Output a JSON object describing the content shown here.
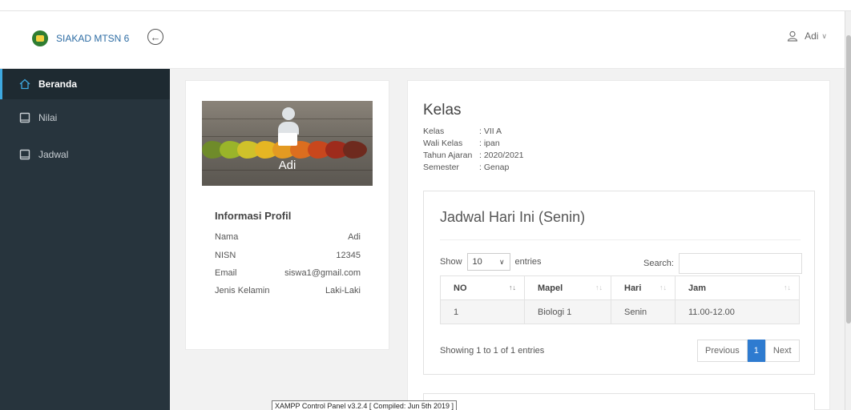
{
  "app": {
    "brand": "SIAKAD MTSN 6",
    "user_name": "Adi"
  },
  "sidebar": {
    "items": [
      {
        "label": "Beranda",
        "icon": "home-icon",
        "active": true
      },
      {
        "label": "Nilai",
        "icon": "book-icon",
        "active": false
      },
      {
        "label": "Jadwal",
        "icon": "book-icon",
        "active": false
      }
    ]
  },
  "profile": {
    "overlay_name": "Adi",
    "title": "Informasi Profil",
    "rows": [
      {
        "label": "Nama",
        "value": "Adi"
      },
      {
        "label": "NISN",
        "value": "12345"
      },
      {
        "label": "Email",
        "value": "siswa1@gmail.com"
      },
      {
        "label": "Jenis Kelamin",
        "value": "Laki-Laki"
      }
    ]
  },
  "kelas": {
    "title": "Kelas",
    "rows": [
      {
        "label": "Kelas",
        "value": ": VII A"
      },
      {
        "label": "Wali Kelas",
        "value": ": ipan"
      },
      {
        "label": "Tahun Ajaran",
        "value": ": 2020/2021"
      },
      {
        "label": "Semester",
        "value": ": Genap"
      }
    ]
  },
  "jadwal": {
    "title": "Jadwal Hari Ini (Senin)",
    "show_label": "Show",
    "entries_value": "10",
    "entries_label": "entries",
    "search_label": "Search:",
    "search_placeholder": "",
    "columns": [
      "NO",
      "Mapel",
      "Hari",
      "Jam"
    ],
    "rows": [
      [
        "1",
        "Biologi 1",
        "Senin",
        "11.00-12.00"
      ]
    ],
    "showing": "Showing 1 to 1 of 1 entries",
    "pager": {
      "previous": "Previous",
      "page": "1",
      "next": "Next"
    }
  },
  "taskbar_tooltip": "XAMPP Control Panel v3.2.4   [ Compiled: Jun 5th 2019 ]",
  "colors": {
    "sidebar_bg": "#27343d",
    "accent": "#3ea9e0",
    "pager_active": "#2e7bd0",
    "brand_text": "#2e6da4"
  }
}
